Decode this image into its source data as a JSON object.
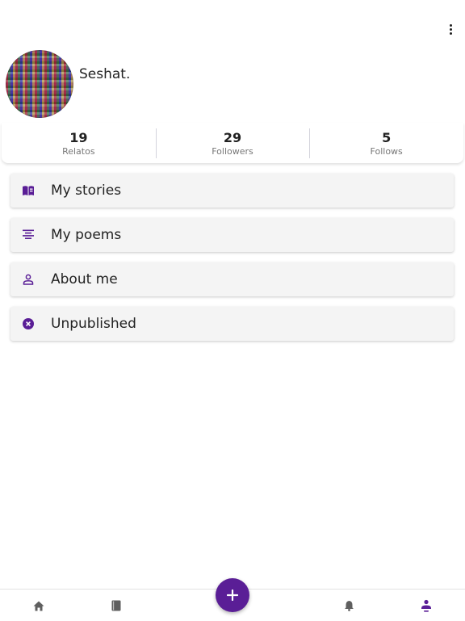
{
  "colors": {
    "accent": "#5a1e96",
    "icon_gray": "#5f5f5f"
  },
  "header": {
    "menu_icon": "more-vert-icon"
  },
  "profile": {
    "username": "Seshat."
  },
  "stats": [
    {
      "value": "19",
      "label": "Relatos"
    },
    {
      "value": "29",
      "label": "Followers"
    },
    {
      "value": "5",
      "label": "Follows"
    }
  ],
  "menu": [
    {
      "label": "My stories",
      "icon": "book-open-icon"
    },
    {
      "label": "My poems",
      "icon": "align-center-icon"
    },
    {
      "label": "About me",
      "icon": "person-outline-icon"
    },
    {
      "label": "Unpublished",
      "icon": "cancel-circle-icon"
    }
  ],
  "bottom_nav": [
    {
      "icon": "home-icon",
      "active": false
    },
    {
      "icon": "book-icon",
      "active": false
    },
    {
      "icon": "bell-icon",
      "active": false
    },
    {
      "icon": "person-icon",
      "active": true
    }
  ],
  "fab": {
    "icon": "plus-icon",
    "label": "+"
  }
}
